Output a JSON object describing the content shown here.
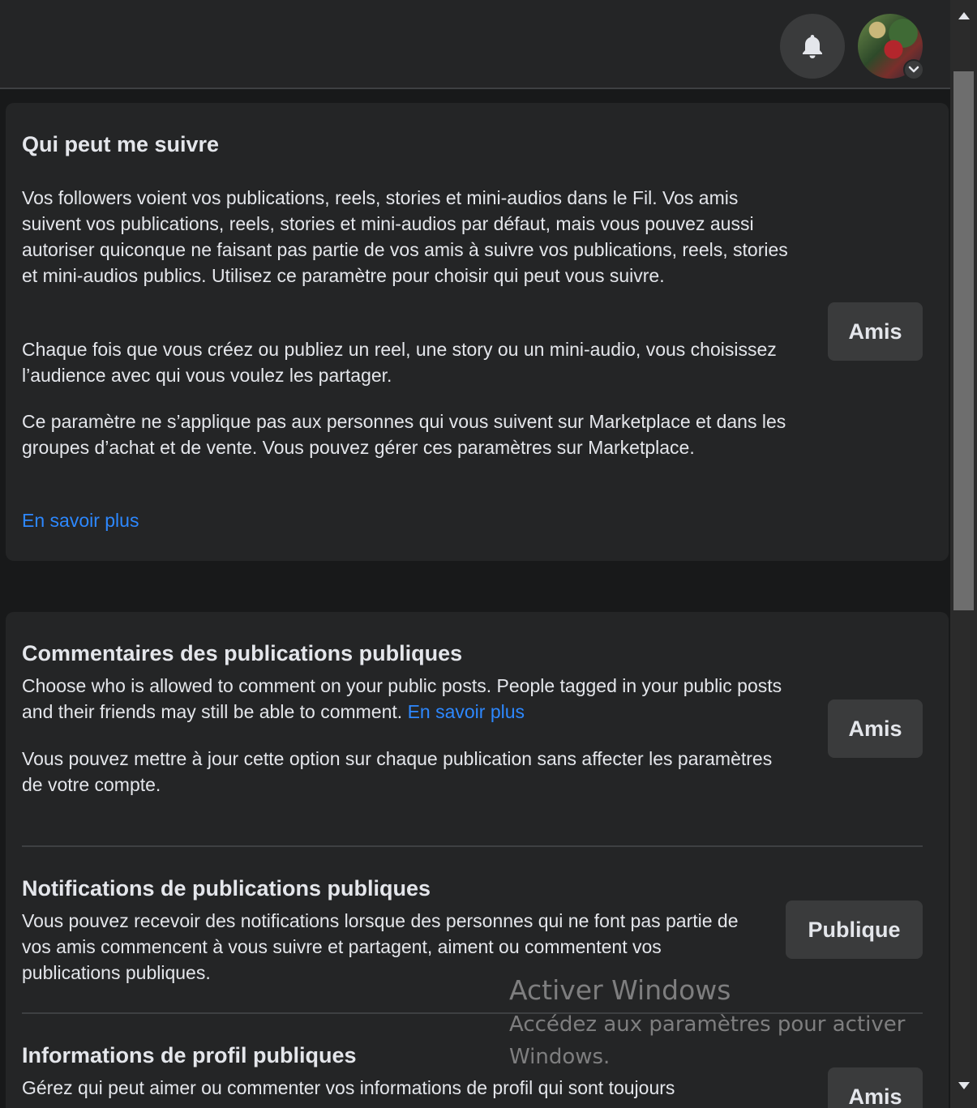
{
  "header": {
    "notifications_icon": "bell-icon",
    "account_icon": "avatar",
    "account_menu_icon": "chevron-down-icon"
  },
  "who_can_follow": {
    "title": "Qui peut me suivre",
    "paragraph1": "Vos followers voient vos publications, reels, stories et mini-audios dans le Fil. Vos amis suivent vos publications, reels, stories et mini-audios par défaut, mais vous pouvez aussi autoriser quiconque ne faisant pas partie de vos amis à suivre vos publications, reels, stories et mini-audios publics. Utilisez ce paramètre pour choisir qui peut vous suivre.",
    "paragraph2": "Chaque fois que vous créez ou publiez un reel, une story ou un mini-audio, vous choisissez l’audience avec qui vous voulez les partager.",
    "paragraph3": "Ce paramètre ne s’applique pas aux personnes qui vous suivent sur Marketplace et dans les groupes d’achat et de vente. Vous pouvez gérer ces paramètres sur Marketplace.",
    "learn_more": "En savoir plus",
    "button": "Amis"
  },
  "public_comments": {
    "title": "Commentaires des publications publiques",
    "description": "Choose who is allowed to comment on your public posts. People tagged in your public posts and their friends may still be able to comment.",
    "learn_more": "En savoir plus",
    "note": "Vous pouvez mettre à jour cette option sur chaque publication sans affecter les paramètres de votre compte.",
    "button": "Amis"
  },
  "public_notifications": {
    "title": "Notifications de publications publiques",
    "description": "Vous pouvez recevoir des notifications lorsque des personnes qui ne font pas partie de vos amis commencent à vous suivre et partagent, aiment ou commentent vos publications publiques.",
    "button": "Publique"
  },
  "public_profile_info": {
    "title": "Informations de profil publiques",
    "description": "Gérez qui peut aimer ou commenter vos informations de profil qui sont toujours",
    "button": "Amis"
  },
  "watermark": {
    "title": "Activer Windows",
    "subtitle": "Accédez aux paramètres pour activer Windows."
  },
  "colors": {
    "background": "#18191a",
    "card": "#242526",
    "button": "#3a3b3c",
    "text": "#e4e6eb",
    "link": "#2d88ff"
  }
}
